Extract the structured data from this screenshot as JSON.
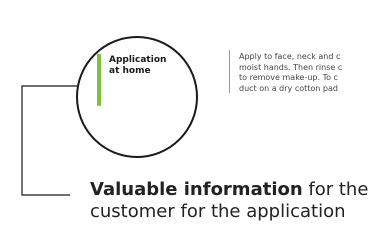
{
  "circle": {
    "title": "Application\nat home"
  },
  "instructions": {
    "lines": [
      "Apply to face, neck and c",
      "moist hands. Then rinse c",
      "to remove make-up. To c",
      "duct on a dry cotton pad"
    ]
  },
  "callout": {
    "bold_text": "Valuable information",
    "rest_line1": " for the",
    "line2": "customer for the application"
  },
  "colors": {
    "accent_green": "#7ac143",
    "line": "#1a1a1a"
  }
}
